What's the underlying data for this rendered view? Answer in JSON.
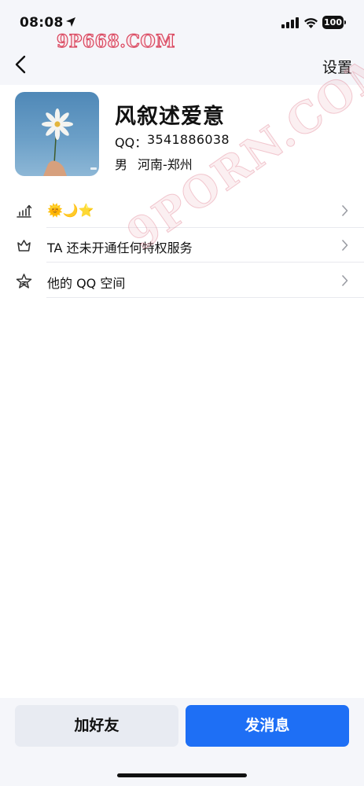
{
  "status_bar": {
    "time": "08:08",
    "battery": "100"
  },
  "watermark": "9P668.COM",
  "watermark_diag": "9PORN.COM",
  "nav": {
    "settings_label": "设置"
  },
  "profile": {
    "nickname": "风叙述爱意",
    "qq_label": "QQ：",
    "qq_number": "3541886038",
    "gender": "男",
    "region": "河南-郑州"
  },
  "rows": [
    {
      "label": "🌞🌙⭐",
      "icon": "level-chart-icon"
    },
    {
      "label": "TA 还未开通任何特权服务",
      "icon": "crown-icon"
    },
    {
      "label": "他的 QQ 空间",
      "icon": "star-space-icon"
    }
  ],
  "actions": {
    "add_friend": "加好友",
    "send_message": "发消息"
  },
  "colors": {
    "primary": "#1e6ff5",
    "secondary_button": "#e8ebf2",
    "background": "#f5f6fa"
  }
}
